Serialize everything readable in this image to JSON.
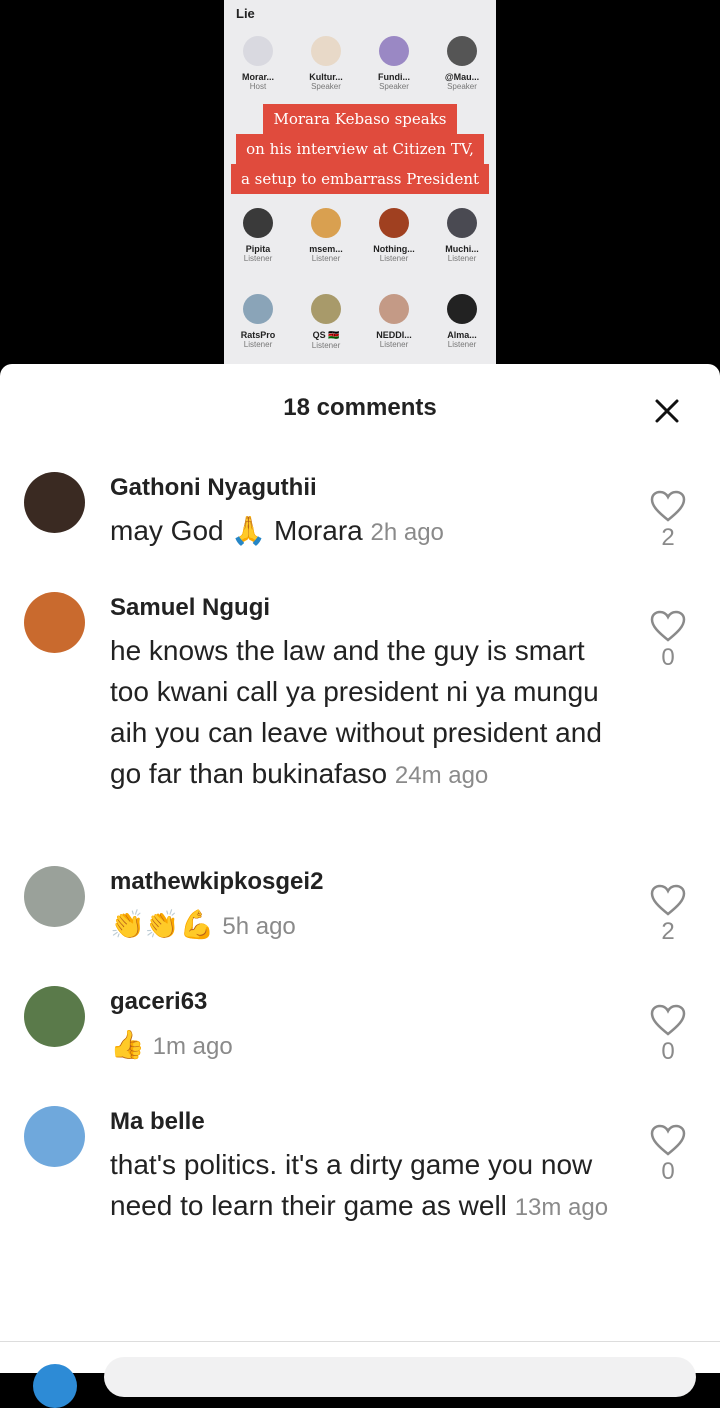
{
  "video": {
    "title": "Lie",
    "row1": [
      {
        "name": "Morar...",
        "role": "Host"
      },
      {
        "name": "Kultur...",
        "role": "Speaker"
      },
      {
        "name": "Fundi...",
        "role": "Speaker"
      },
      {
        "name": "@Mau...",
        "role": "Speaker"
      }
    ],
    "banner": [
      "Morara Kebaso speaks",
      "on his interview at Citizen TV,",
      "a setup to embarrass President"
    ],
    "row2": [
      {
        "name": "Pipita",
        "role": "Listener"
      },
      {
        "name": "msem...",
        "role": "Listener"
      },
      {
        "name": "Nothing...",
        "role": "Listener"
      },
      {
        "name": "Muchi...",
        "role": "Listener"
      }
    ],
    "row3": [
      {
        "name": "RatsPro",
        "role": "Listener"
      },
      {
        "name": "QS 🇰🇪",
        "role": "Listener"
      },
      {
        "name": "NEDDI...",
        "role": "Listener"
      },
      {
        "name": "Alma...",
        "role": "Listener"
      }
    ]
  },
  "sheet": {
    "title": "18 comments",
    "close_icon": "close-icon"
  },
  "comments": [
    {
      "user": "Gathoni Nyaguthii",
      "text": "may God 🙏 Morara",
      "time": "2h ago",
      "likes": "2",
      "avatar_color": "#3a2a22"
    },
    {
      "user": "Samuel Ngugi",
      "text": "he knows the law and the guy is smart too kwani call ya president ni ya mungu aih you can leave without president and go far than bukinafaso",
      "time": "24m ago",
      "likes": "0",
      "avatar_color": "#c96a2e"
    },
    {
      "user": "mathewkipkosgei2",
      "text": "👏👏💪",
      "time": "5h ago",
      "likes": "2",
      "avatar_color": "#9aa19a"
    },
    {
      "user": "gaceri63",
      "text": "👍",
      "time": "1m ago",
      "likes": "0",
      "avatar_color": "#5a7a4a"
    },
    {
      "user": "Ma belle",
      "text": "that's politics. it's a dirty game you now need to learn their game as well",
      "time": "13m ago",
      "likes": "0",
      "avatar_color": "#6fa8dc"
    }
  ],
  "colors": {
    "banner": "#e04b3d",
    "muted": "#8a8a8a",
    "text": "#222222"
  }
}
